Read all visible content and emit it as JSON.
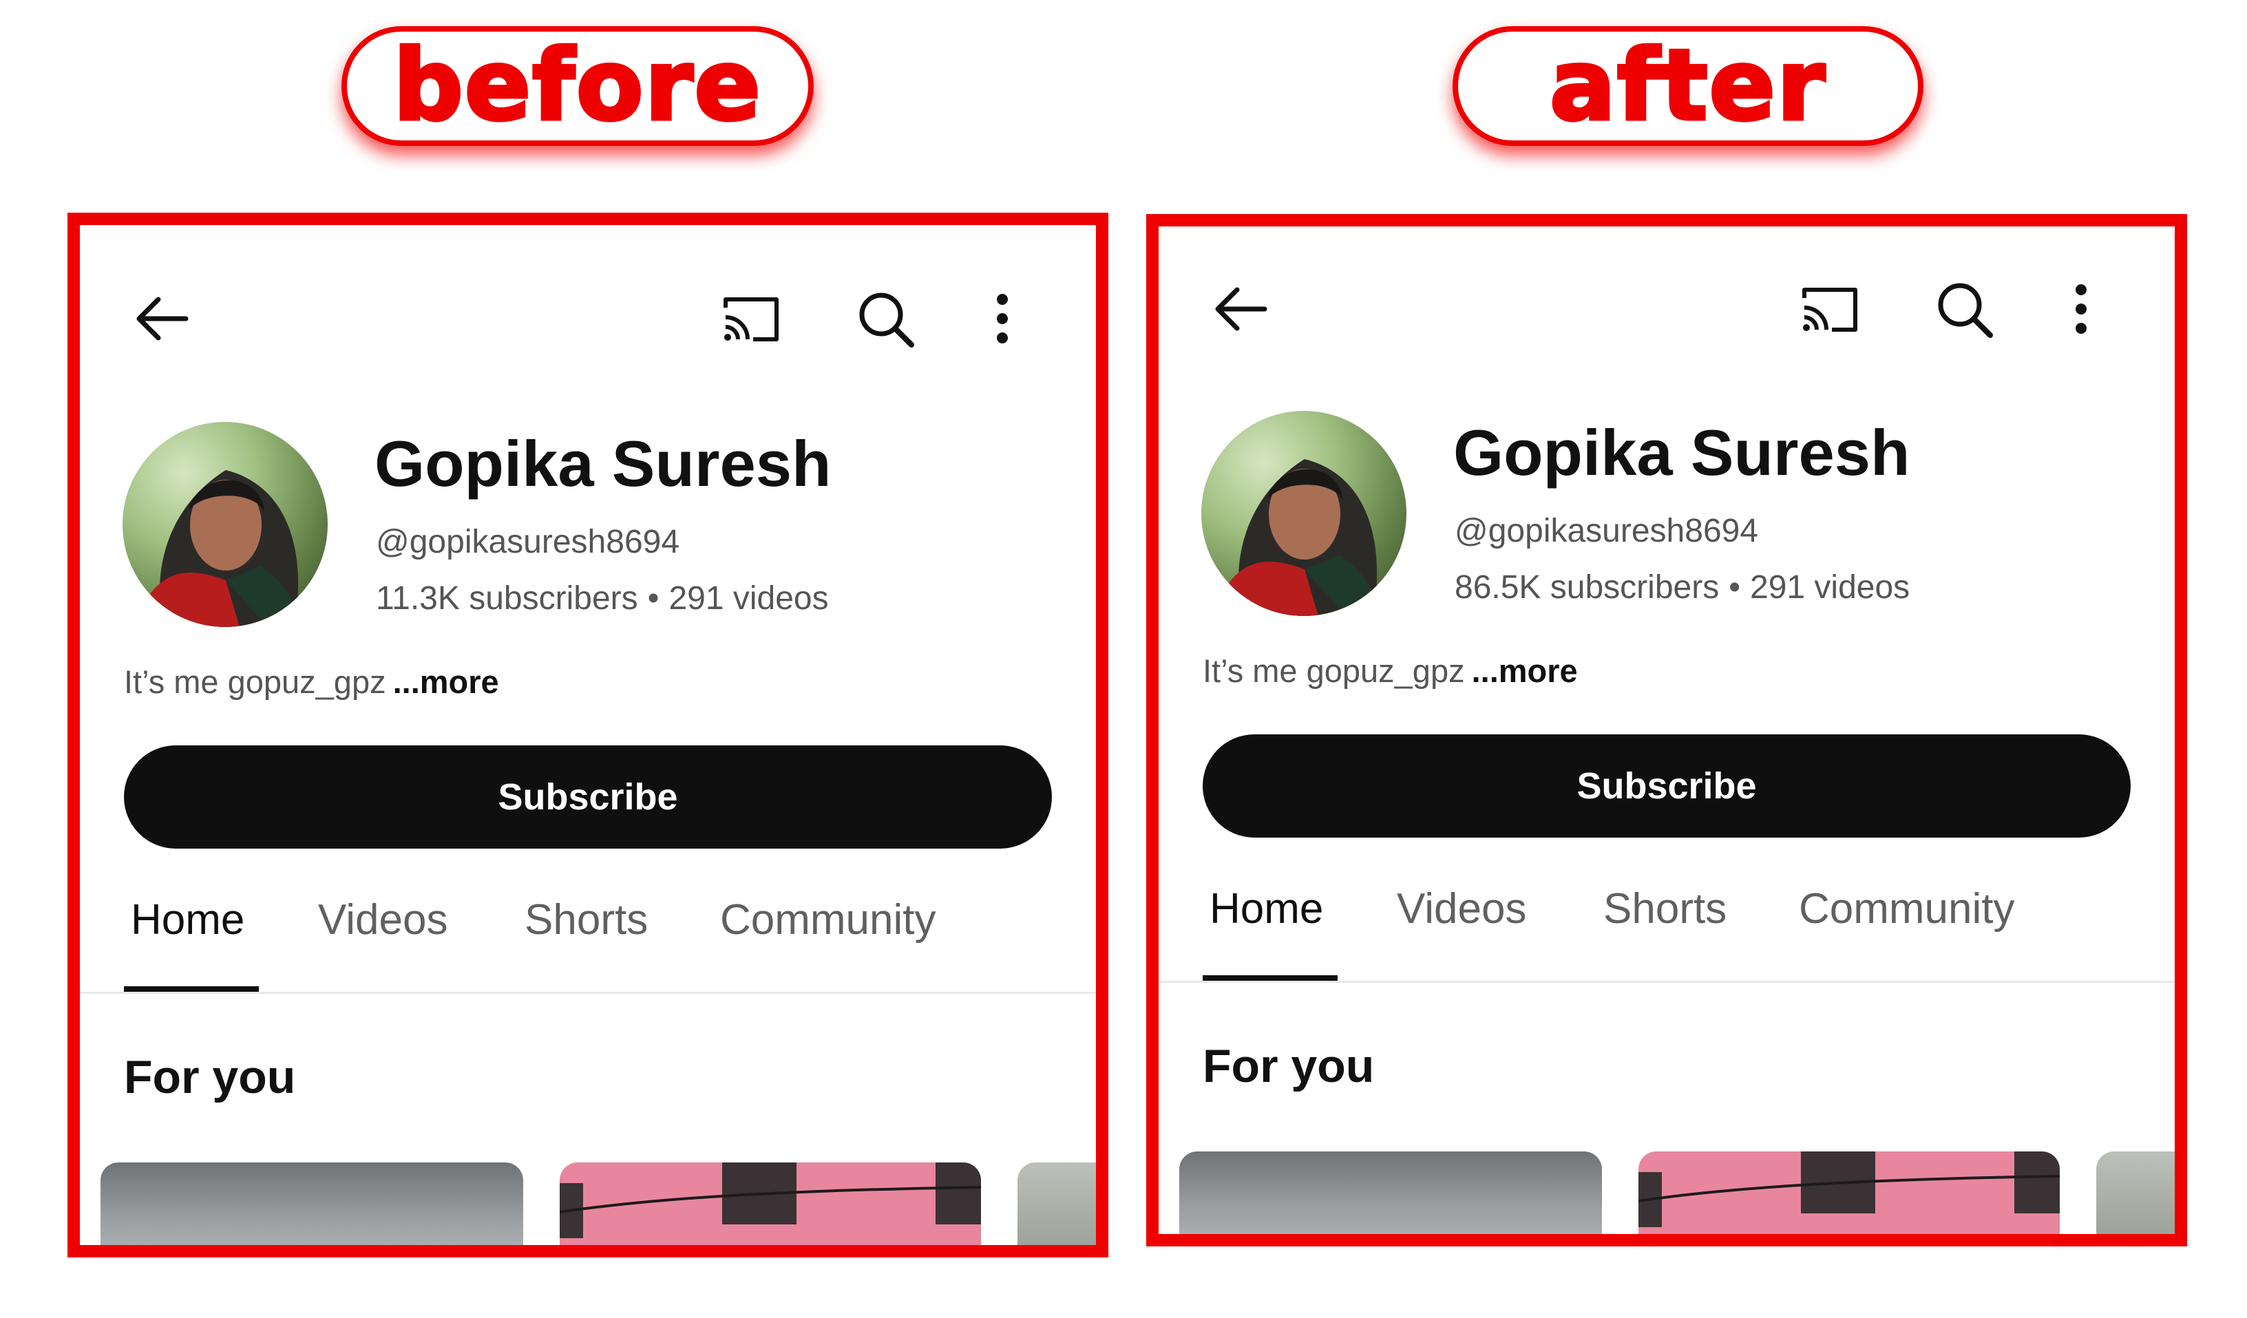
{
  "labels": {
    "before": "before",
    "after": "after"
  },
  "colors": {
    "accent": "#ee0000",
    "button_bg": "#0f0f0f",
    "tab_active": "#0f0f0f",
    "tab_inactive": "#606060"
  },
  "icons": [
    "back-arrow-icon",
    "cast-icon",
    "search-icon",
    "more-vert-icon"
  ],
  "panels": [
    {
      "channel_name": "Gopika Suresh",
      "handle": "@gopikasuresh8694",
      "subscribers": "11.3K subscribers",
      "videos": "291 videos",
      "separator": "•",
      "description": "It’s me gopuz_gpz",
      "more": "...more",
      "subscribe_label": "Subscribe",
      "tabs": [
        "Home",
        "Videos",
        "Shorts",
        "Community"
      ],
      "active_tab": "Home",
      "section_title": "For you"
    },
    {
      "channel_name": "Gopika Suresh",
      "handle": "@gopikasuresh8694",
      "subscribers": "86.5K subscribers",
      "videos": "291 videos",
      "separator": "•",
      "description": "It’s me gopuz_gpz",
      "more": "...more",
      "subscribe_label": "Subscribe",
      "tabs": [
        "Home",
        "Videos",
        "Shorts",
        "Community"
      ],
      "active_tab": "Home",
      "section_title": "For you"
    }
  ]
}
